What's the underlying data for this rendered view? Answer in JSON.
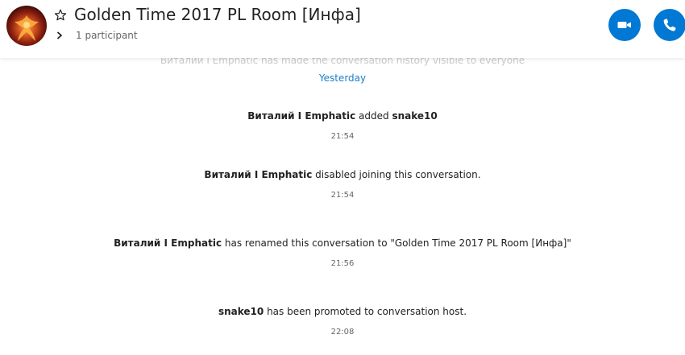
{
  "header": {
    "title": "Golden Time 2017 PL Room [Инфа]",
    "participants": "1 participant",
    "avatar_icon": "phoenix-avatar",
    "favorite_icon": "star-icon",
    "expand_icon": "chevron-right-icon",
    "video_call_icon": "video-camera-icon",
    "audio_call_icon": "phone-icon",
    "accent_color": "#0078d4"
  },
  "chat": {
    "faded_previous": "Виталий I Emphatic has made the conversation history visible to everyone",
    "date_separator": "Yesterday",
    "events": [
      {
        "actor": "Виталий I Emphatic",
        "text": " added ",
        "target": "snake10",
        "time": "21:54"
      },
      {
        "actor": "Виталий I Emphatic",
        "text": " disabled joining this conversation.",
        "target": "",
        "time": "21:54"
      },
      {
        "actor": "Виталий I Emphatic",
        "text": " has renamed this conversation to \"Golden Time 2017 PL Room [Инфа]\"",
        "target": "",
        "time": "21:56"
      },
      {
        "actor": "snake10",
        "text": " has been promoted to conversation host.",
        "target": "",
        "time": "22:08"
      }
    ]
  }
}
